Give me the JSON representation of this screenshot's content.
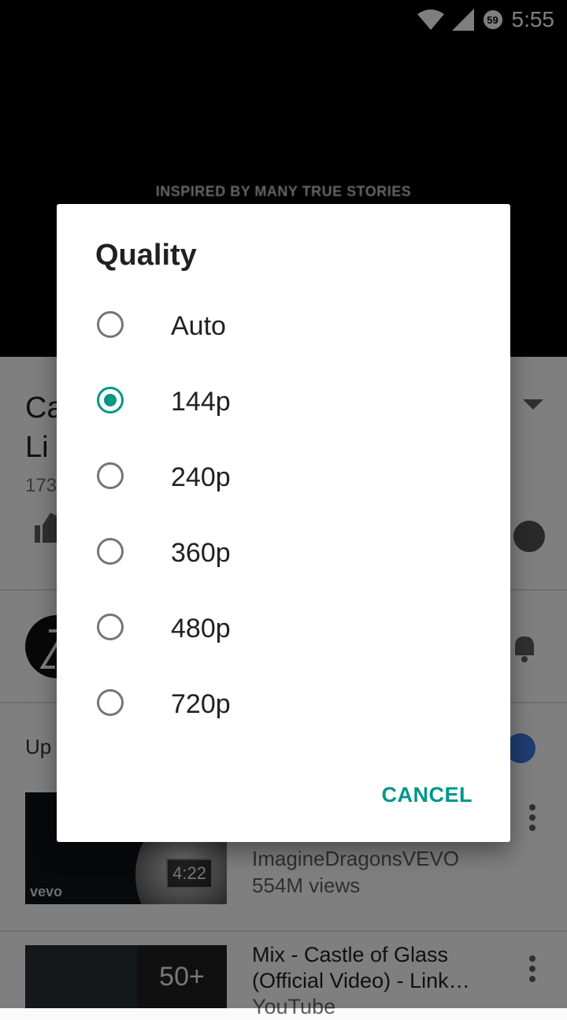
{
  "status_bar": {
    "time": "5:55",
    "notification_count": "59",
    "icons": [
      "wifi-icon",
      "signal-icon"
    ]
  },
  "player": {
    "caption": "INSPIRED BY MANY TRUE STORIES"
  },
  "video": {
    "title_partial": "Ca\nLi",
    "views_partial": "173"
  },
  "up_next": {
    "label": "Up"
  },
  "related": [
    {
      "channel": "ImagineDragonsVEVO",
      "views": "554M views",
      "duration": "4:22",
      "brand": "vevo"
    },
    {
      "title": "Mix - Castle of Glass (Official Video) - Link…",
      "sub": "YouTube",
      "count": "50+"
    }
  ],
  "dialog": {
    "title": "Quality",
    "options": [
      {
        "label": "Auto",
        "selected": false
      },
      {
        "label": "144p",
        "selected": true
      },
      {
        "label": "240p",
        "selected": false
      },
      {
        "label": "360p",
        "selected": false
      },
      {
        "label": "480p",
        "selected": false
      },
      {
        "label": "720p",
        "selected": false
      }
    ],
    "cancel_label": "CANCEL"
  },
  "colors": {
    "accent": "#009688",
    "scrim": "rgba(0,0,0,0.5)"
  }
}
